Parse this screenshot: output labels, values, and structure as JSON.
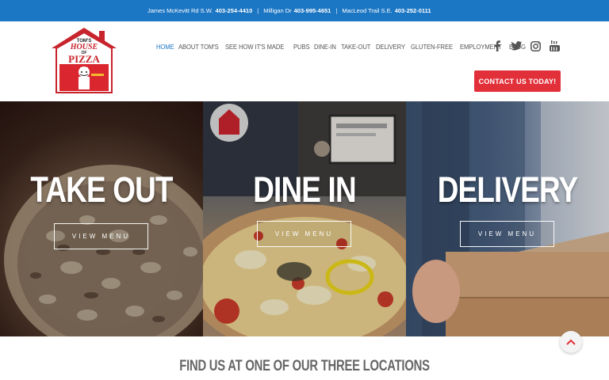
{
  "topbar": {
    "locations": [
      {
        "address": "James McKevitt Rd S.W.",
        "phone": "403-254-4410"
      },
      {
        "address": "Milligan Dr",
        "phone": "403-995-4651"
      },
      {
        "address": "MacLeod Trail S.E.",
        "phone": "403-252-0111"
      }
    ],
    "separator": "|"
  },
  "logo": {
    "line1": "TOM'S",
    "line2": "HOUSE",
    "line3": "OF",
    "line4": "PIZZA"
  },
  "nav": {
    "items": [
      {
        "label": "HOME",
        "active": true
      },
      {
        "label": "ABOUT TOM'S",
        "active": false
      },
      {
        "label": "SEE HOW IT'S MADE",
        "active": false
      },
      {
        "label": "PUBS",
        "active": false
      },
      {
        "label": "DINE-IN",
        "active": false
      },
      {
        "label": "TAKE-OUT",
        "active": false
      },
      {
        "label": "DELIVERY",
        "active": false
      },
      {
        "label": "GLUTEN-FREE",
        "active": false
      },
      {
        "label": "EMPLOYMENT",
        "active": false
      },
      {
        "label": "BLOG",
        "active": false
      }
    ]
  },
  "social": {
    "icons": [
      "facebook-icon",
      "twitter-icon",
      "instagram-icon",
      "youtube-icon"
    ]
  },
  "cta": {
    "label": "CONTACT US TODAY!"
  },
  "hero": {
    "panels": [
      {
        "title": "TAKE OUT",
        "button": "VIEW MENU"
      },
      {
        "title": "DINE IN",
        "button": "VIEW MENU"
      },
      {
        "title": "DELIVERY",
        "button": "VIEW MENU"
      }
    ]
  },
  "locations": {
    "title": "FIND US AT ONE OF OUR THREE LOCATIONS"
  },
  "colors": {
    "brand_blue": "#1b76c4",
    "cta_red": "#e2303a",
    "text_gray": "#555555"
  }
}
